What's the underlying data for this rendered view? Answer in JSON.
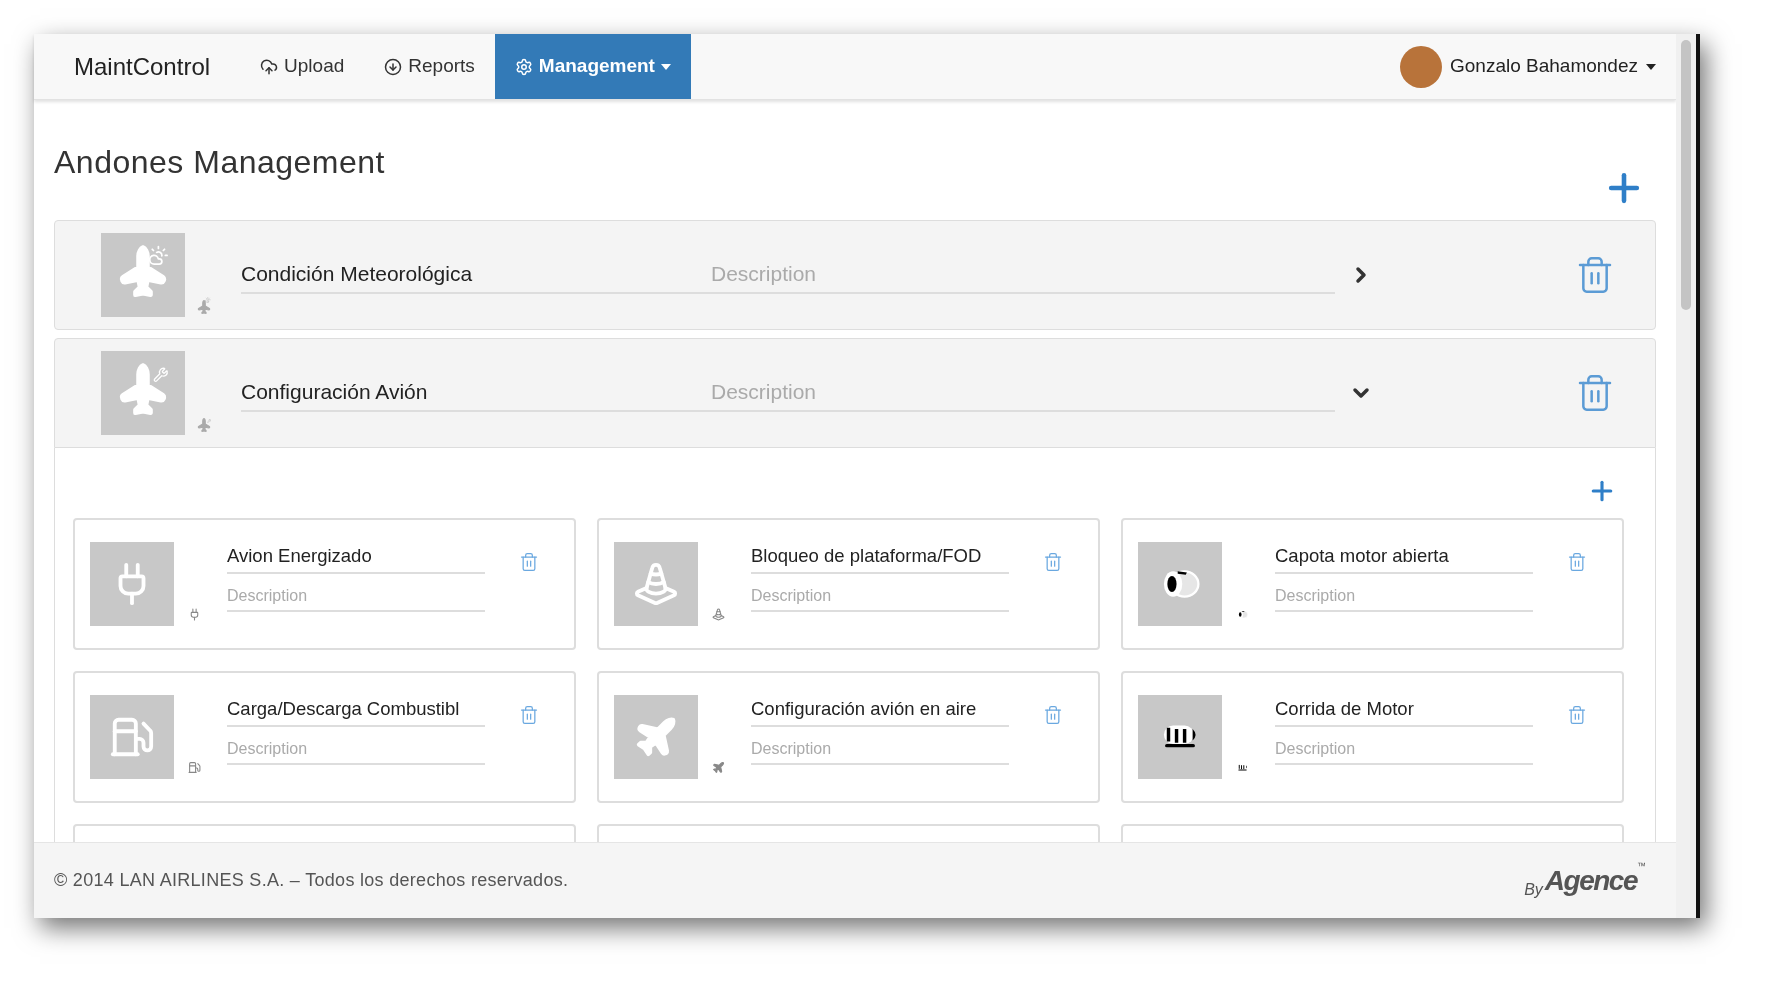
{
  "navbar": {
    "brand": "MaintControl",
    "items": [
      {
        "label": "Upload",
        "kind": "upload",
        "selected": false,
        "dropdown": false
      },
      {
        "label": "Reports",
        "kind": "download",
        "selected": false,
        "dropdown": false
      },
      {
        "label": "Management",
        "kind": "gear",
        "selected": true,
        "dropdown": true
      }
    ],
    "user": {
      "name": "Gonzalo Bahamondez"
    }
  },
  "page": {
    "title": "Andones Management"
  },
  "andones": [
    {
      "name": "Condición Meteorológica",
      "placeholder": "Description",
      "kind": "plane-weather",
      "expanded": false
    },
    {
      "name": "Configuración Avión",
      "placeholder": "Description",
      "kind": "plane-wrench",
      "expanded": true,
      "children": [
        {
          "name": "Avion Energizado",
          "placeholder": "Description",
          "kind": "plug"
        },
        {
          "name": "Bloqueo de plataforma/FOD",
          "placeholder": "Description",
          "kind": "cone"
        },
        {
          "name": "Capota motor abierta",
          "placeholder": "Description",
          "kind": "engine-open"
        },
        {
          "name": "Carga/Descarga Combustibl",
          "placeholder": "Description",
          "kind": "fuel"
        },
        {
          "name": "Configuración avión en aire",
          "placeholder": "Description",
          "kind": "plane"
        },
        {
          "name": "Corrida de Motor",
          "placeholder": "Description",
          "kind": "engine-run"
        }
      ]
    }
  ],
  "footer": {
    "copyright": "© 2014 LAN AIRLINES S.A. – Todos los derechos reservados.",
    "brand_prefix": "By",
    "brand": "Agence",
    "brand_mark": "™"
  }
}
